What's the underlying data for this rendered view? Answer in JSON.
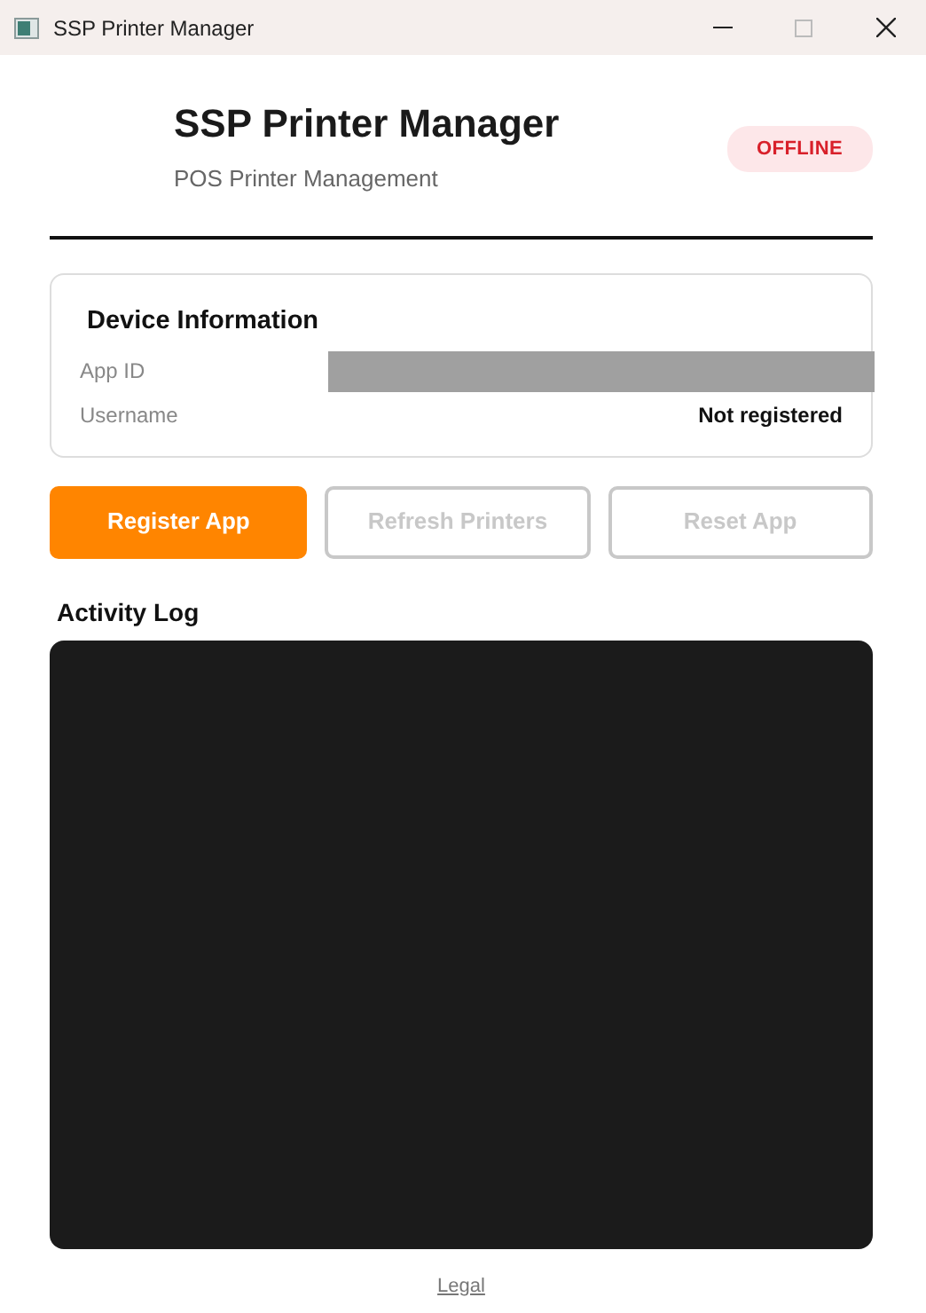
{
  "window": {
    "title": "SSP Printer Manager"
  },
  "header": {
    "title": "SSP Printer Manager",
    "subtitle": "POS Printer Management",
    "status": {
      "label": "OFFLINE",
      "online": false
    }
  },
  "device_info": {
    "title": "Device Information",
    "fields": [
      {
        "label": "App ID",
        "redacted": true
      },
      {
        "label": "Username",
        "value": "Not registered"
      }
    ]
  },
  "buttons": [
    {
      "label": "Register App",
      "kind": "primary",
      "disabled": false
    },
    {
      "label": "Refresh Printers",
      "kind": "outline",
      "disabled": true
    },
    {
      "label": "Reset App",
      "kind": "outline",
      "disabled": true
    }
  ],
  "activity_log": {
    "title": "Activity Log"
  },
  "footer": {
    "link": "Legal"
  }
}
